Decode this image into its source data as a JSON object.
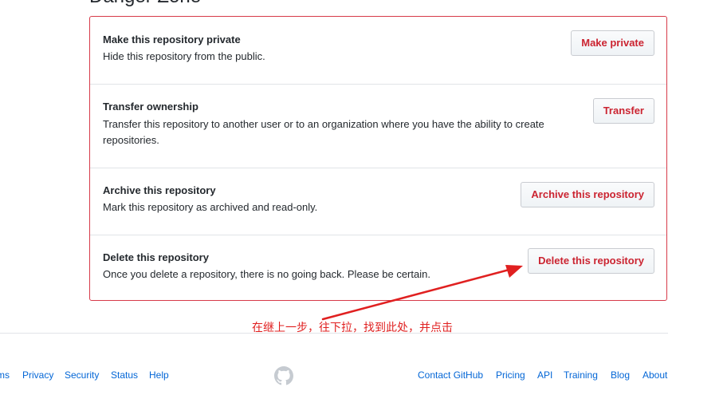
{
  "section": {
    "title": "Danger Zone"
  },
  "danger_rows": [
    {
      "title": "Make this repository private",
      "description": "Hide this repository from the public.",
      "button": "Make private"
    },
    {
      "title": "Transfer ownership",
      "description": "Transfer this repository to another user or to an organization where you have the ability to create repositories.",
      "button": "Transfer"
    },
    {
      "title": "Archive this repository",
      "description": "Mark this repository as archived and read-only.",
      "button": "Archive this repository"
    },
    {
      "title": "Delete this repository",
      "description": "Once you delete a repository, there is no going back. Please be certain.",
      "button": "Delete this repository"
    }
  ],
  "annotation": {
    "text": "在继上一步，往下拉，找到此处，并点击",
    "color": "#e02020"
  },
  "footer": {
    "left_links": [
      "ms",
      "Privacy",
      "Security",
      "Status",
      "Help"
    ],
    "logo_icon": "github-octocat-icon",
    "right_links": [
      "Contact GitHub",
      "Pricing",
      "API",
      "Training",
      "Blog",
      "About"
    ]
  },
  "colors": {
    "danger_border": "#d73a49",
    "danger_text": "#cb2431",
    "link": "#0366d6"
  }
}
